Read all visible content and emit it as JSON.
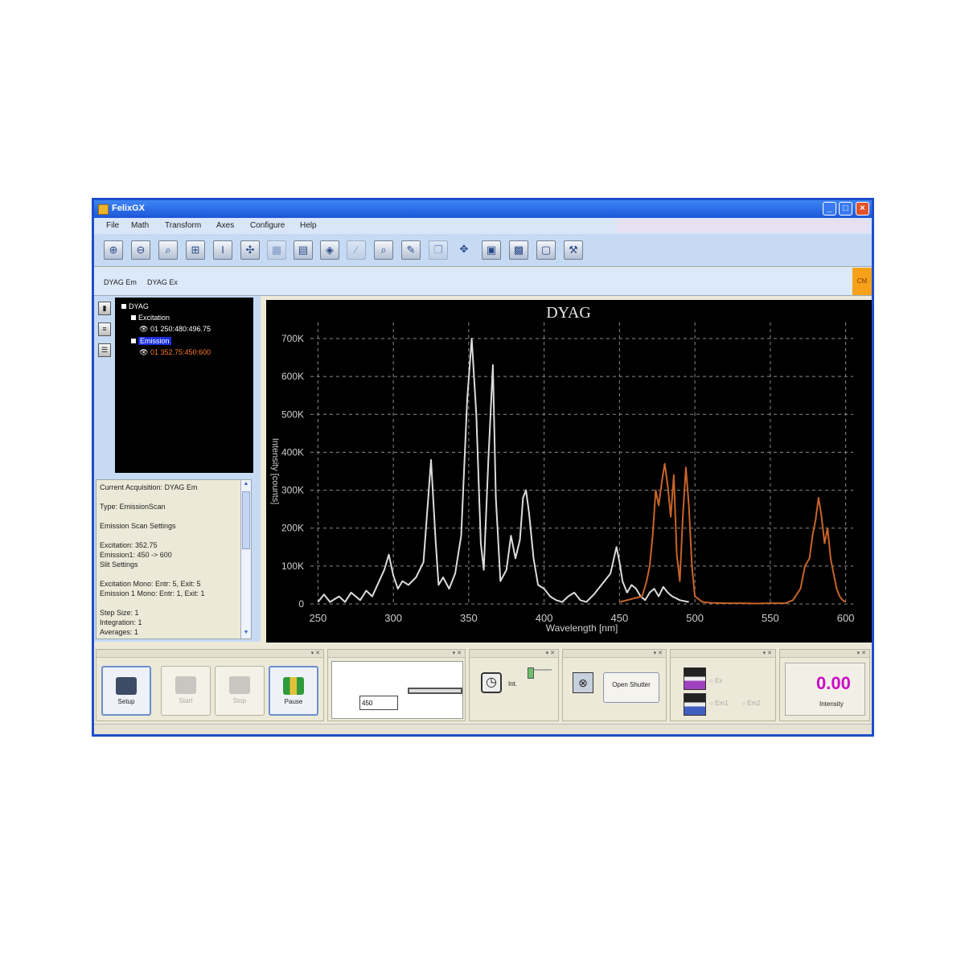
{
  "window": {
    "title": "FelixGX"
  },
  "menu": [
    "File",
    "Math",
    "Transform",
    "Axes",
    "Configure",
    "Help"
  ],
  "toolbar_icons": [
    "zoom-in-icon",
    "zoom-out-icon",
    "magnify-icon",
    "fit-icon",
    "pan-vertical-icon",
    "fan-icon",
    "grid-icon",
    "table-icon",
    "palette-icon",
    "line-icon",
    "search-icon",
    "edit-icon",
    "copy-icon",
    "move-icon",
    "image-icon",
    "color-chart-icon",
    "frame-icon",
    "tools-icon"
  ],
  "datasets": [
    "DYAG Em",
    "DYAG Ex"
  ],
  "datasets_badge": "CM",
  "tree": {
    "root": "DYAG",
    "excitation_label": "Excitation",
    "excitation_trace": "01 250:480:496.75",
    "emission_label": "Emission",
    "emission_trace": "01 352.75:450:600"
  },
  "info_lines": [
    "Current Acquisition: DYAG Em",
    "Type: EmissionScan",
    "Emission Scan Settings",
    "Excitation: 352.75",
    "Emission1: 450 -> 600",
    "Slit Settings",
    "Excitation Mono: Entr: 5, Exit: 5",
    "Emission 1 Mono: Entr: 1, Exit: 1",
    "Step Size: 1",
    "Integration: 1",
    "Averages: 1"
  ],
  "controls": {
    "setup": "Setup",
    "start": "Start",
    "stop": "Stop",
    "pause": "Pause",
    "wavelength_value": "450",
    "int_label": "Int.",
    "open_shutter": "Open Shutter",
    "ex_label": "Ex",
    "em1_label": "Em1",
    "em2_label": "Em2",
    "intensity_value": "0.00",
    "intensity_label": "Intensity"
  },
  "colors": {
    "excitation_trace": "#dcdcdc",
    "emission_trace": "#c8642a",
    "plot_bg": "#000000",
    "intensity_value": "#cc0cc7"
  },
  "chart_data": {
    "type": "line",
    "title": "DYAG",
    "xlabel": "Wavelength [nm]",
    "ylabel": "Intensity [counts]",
    "xlim": [
      245,
      605
    ],
    "ylim": [
      0,
      700000
    ],
    "xticks": [
      "250",
      "300",
      "350",
      "400",
      "450",
      "500",
      "550",
      "600"
    ],
    "yticks": [
      "0",
      "100K",
      "200K",
      "300K",
      "400K",
      "500K",
      "600K",
      "700K"
    ],
    "grid": true,
    "series": [
      {
        "name": "Excitation",
        "x": [
          250,
          254,
          256,
          258,
          264,
          268,
          272,
          278,
          282,
          286,
          290,
          294,
          297,
          300,
          303,
          306,
          310,
          315,
          320,
          325,
          328,
          330,
          333,
          337,
          341,
          345,
          349,
          352,
          355,
          358,
          360,
          363,
          366,
          368,
          371,
          375,
          378,
          381,
          384,
          386,
          388,
          390,
          393,
          396,
          400,
          404,
          408,
          412,
          416,
          420,
          424,
          428,
          433,
          438,
          444,
          448,
          450,
          452,
          455,
          458,
          461,
          464,
          467,
          470,
          473,
          476,
          479,
          482,
          485,
          490,
          496
        ],
        "y": [
          5000,
          25000,
          15000,
          5000,
          20000,
          5000,
          30000,
          10000,
          35000,
          20000,
          55000,
          90000,
          130000,
          75000,
          40000,
          60000,
          50000,
          70000,
          110000,
          380000,
          170000,
          50000,
          70000,
          40000,
          80000,
          180000,
          540000,
          700000,
          500000,
          160000,
          90000,
          380000,
          630000,
          280000,
          60000,
          90000,
          180000,
          120000,
          170000,
          280000,
          300000,
          240000,
          120000,
          50000,
          40000,
          20000,
          10000,
          5000,
          20000,
          30000,
          10000,
          5000,
          25000,
          50000,
          80000,
          150000,
          110000,
          60000,
          30000,
          50000,
          40000,
          20000,
          10000,
          30000,
          40000,
          20000,
          45000,
          30000,
          20000,
          10000,
          5000
        ]
      },
      {
        "name": "Emission",
        "x": [
          450,
          455,
          460,
          465,
          468,
          470,
          472,
          474,
          476,
          478,
          480,
          482,
          484,
          486,
          488,
          490,
          492,
          494,
          496,
          498,
          500,
          505,
          510,
          520,
          530,
          540,
          550,
          560,
          565,
          570,
          573,
          576,
          578,
          580,
          582,
          584,
          586,
          588,
          590,
          592,
          594,
          596,
          598,
          600
        ],
        "y": [
          5000,
          10000,
          15000,
          20000,
          60000,
          100000,
          180000,
          300000,
          260000,
          320000,
          370000,
          310000,
          230000,
          340000,
          130000,
          60000,
          230000,
          360000,
          260000,
          100000,
          20000,
          5000,
          3000,
          2000,
          2000,
          1000,
          2000,
          2000,
          10000,
          40000,
          100000,
          120000,
          180000,
          220000,
          280000,
          230000,
          160000,
          200000,
          120000,
          80000,
          40000,
          20000,
          10000,
          5000
        ]
      }
    ]
  }
}
